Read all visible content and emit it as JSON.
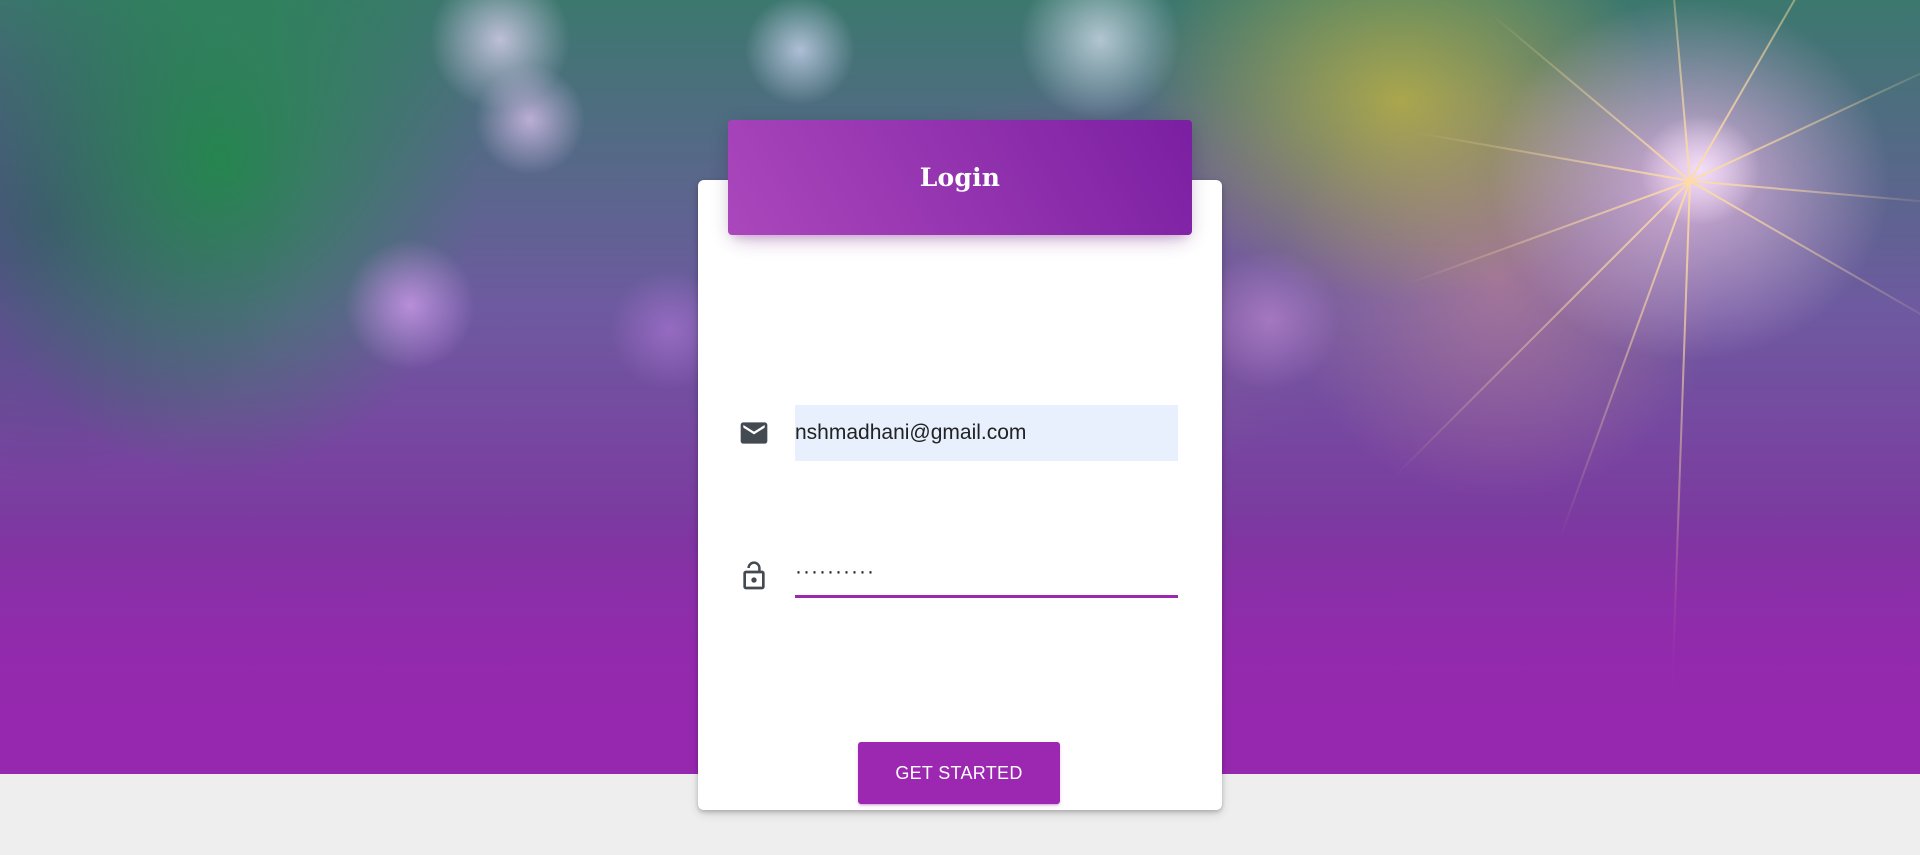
{
  "login_card": {
    "title": "Login",
    "email": {
      "icon": "mail-icon",
      "value": "nshmadhani@gmail.com"
    },
    "password": {
      "icon": "lock-icon",
      "value": "··········"
    },
    "submit_label": "GET STARTED"
  },
  "colors": {
    "primary": "#9c27b0",
    "primary_dark": "#7b1fa2",
    "primary_light": "#ab47bc",
    "autofill_bg": "#e8f0fe",
    "page_bg": "#eeeeee"
  }
}
